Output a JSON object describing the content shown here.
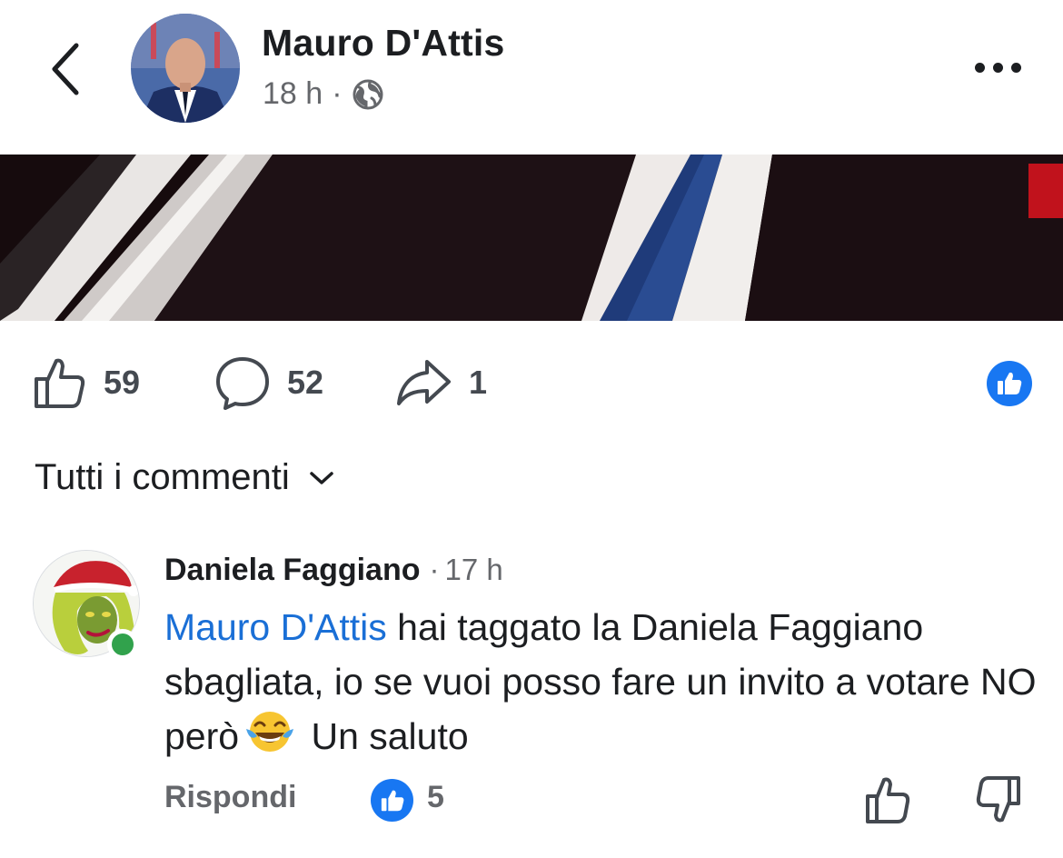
{
  "post": {
    "author": "Mauro D'Attis",
    "time": "18 h",
    "separator": "·"
  },
  "actions": {
    "likes": "59",
    "comments": "52",
    "shares": "1"
  },
  "comments_section": {
    "filter_label": "Tutti i commenti"
  },
  "comment": {
    "author": "Daniela Faggiano",
    "time_prefix": "·",
    "time": "17 h",
    "mention": "Mauro D'Attis",
    "text_1": " hai taggato la Daniela Faggiano sbagliata, io se vuoi posso fare un invito a votare NO però",
    "text_2": " Un saluto",
    "reply_label": "Rispondi",
    "like_count": "5"
  },
  "colors": {
    "accent_blue": "#1877f2",
    "mention_blue": "#1a6fd6",
    "online_green": "#31a24c"
  }
}
